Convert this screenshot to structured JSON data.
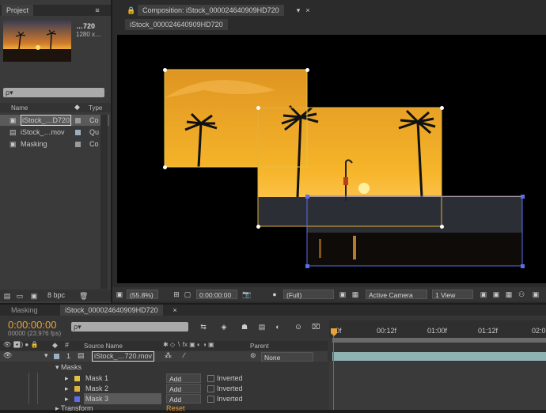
{
  "project": {
    "tab_label": "Project",
    "thumb_name": "…720",
    "thumb_res": "1280 x…",
    "search_placeholder": "ρ▾",
    "col_name": "Name",
    "col_type": "Type",
    "items": [
      {
        "name": "iStock_…D720",
        "type": "Co",
        "swatch": "#9a9a9a"
      },
      {
        "name": "iStock_…mov",
        "type": "Qu",
        "swatch": "#9ab0c0"
      },
      {
        "name": "Masking",
        "type": "Co",
        "swatch": "#9a9a9a"
      }
    ],
    "bpc": "8 bpc"
  },
  "composition": {
    "tab_label": "Composition: iStock_000024640909HD720",
    "subtab_label": "iStock_000024640909HD720",
    "zoom": "(55.8%)",
    "timecode": "0:00:00:00",
    "resolution": "(Full)",
    "camera": "Active Camera",
    "view": "1 View"
  },
  "timeline": {
    "tab_masking": "Masking",
    "tab_main": "iStock_000024640909HD720",
    "timecode": "0:00:00:00",
    "fps": "00000 (23.976 fps)",
    "search_placeholder": "ρ▾",
    "col_source": "Source Name",
    "col_parent": "Parent",
    "layer_num": "1",
    "layer_name": "iStock_…720.mov",
    "parent_value": "None",
    "masks_group": "Masks",
    "masks": [
      {
        "name": "Mask 1",
        "mode": "Add",
        "inverted": "Inverted",
        "color": "#e0c24a"
      },
      {
        "name": "Mask 2",
        "mode": "Add",
        "inverted": "Inverted",
        "color": "#e0b040"
      },
      {
        "name": "Mask 3",
        "mode": "Add",
        "inverted": "Inverted",
        "color": "#5b6ee8"
      }
    ],
    "transform_label": "Transform",
    "reset_label": "Reset",
    "ruler": [
      "0f",
      "00:12f",
      "01:00f",
      "01:12f",
      "02:0"
    ]
  },
  "colors": {
    "accent_orange": "#e8a23a",
    "mask_blue": "#5b6ee8"
  }
}
